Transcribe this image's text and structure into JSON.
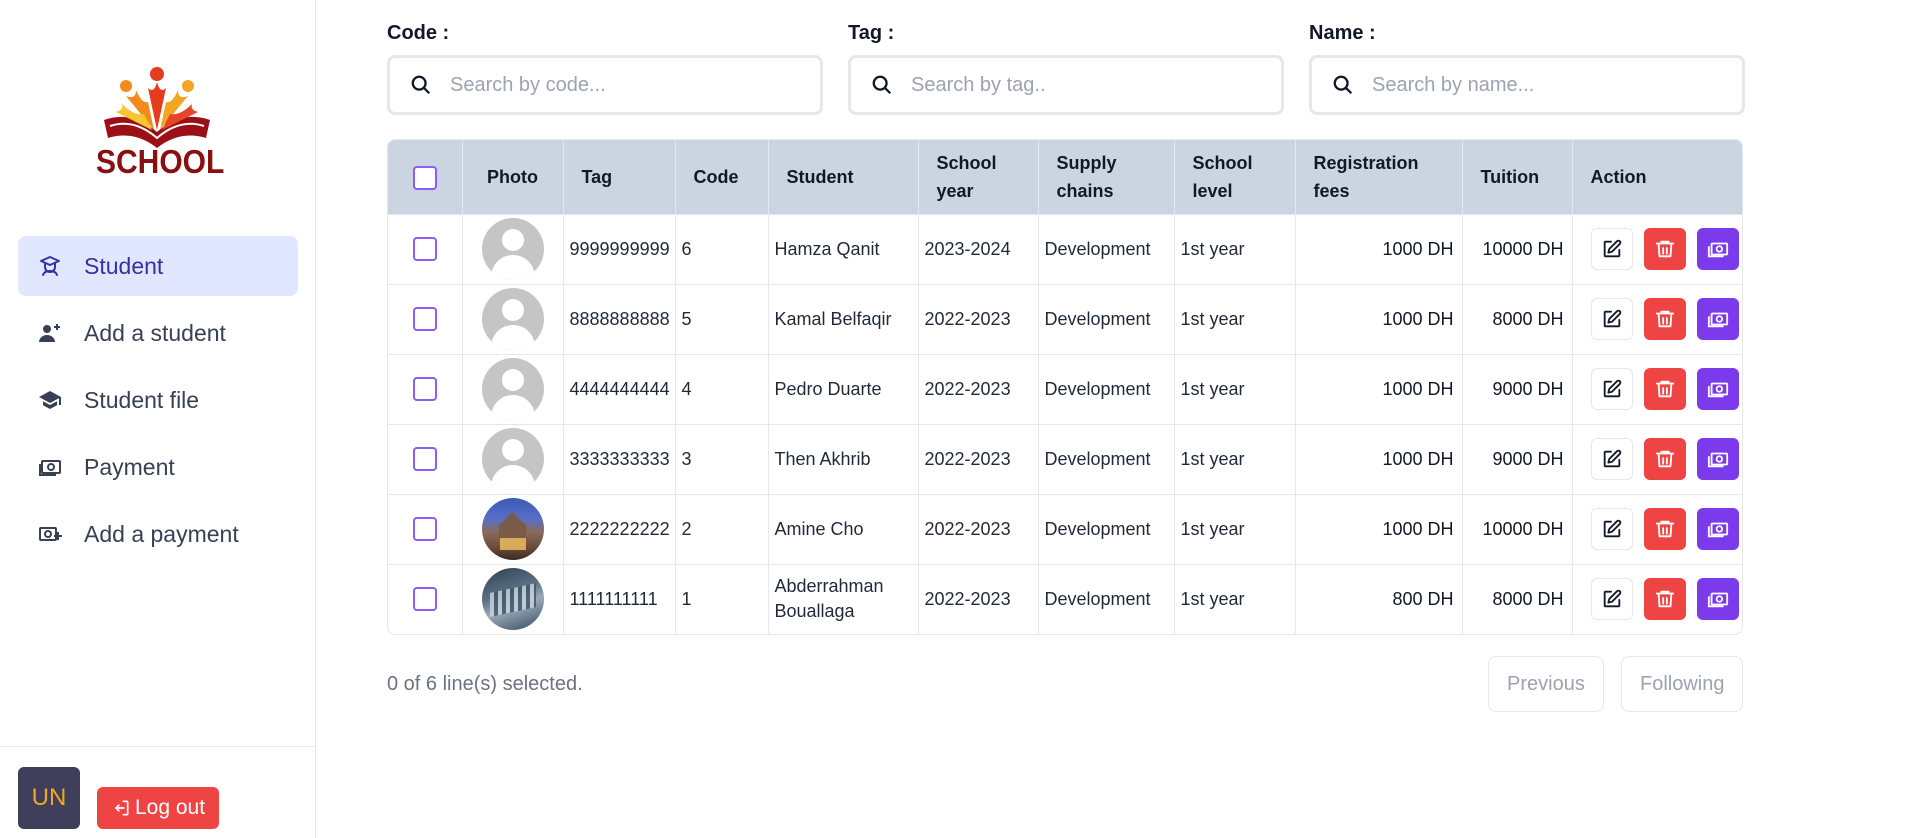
{
  "logo": {
    "text": "SCHOOL"
  },
  "sidebar": {
    "items": [
      {
        "label": "Student",
        "icon": "student-icon"
      },
      {
        "label": "Add a student",
        "icon": "add-user-icon"
      },
      {
        "label": "Student file",
        "icon": "graduation-cap-icon"
      },
      {
        "label": "Payment",
        "icon": "money-icon"
      },
      {
        "label": "Add a payment",
        "icon": "add-money-icon"
      }
    ],
    "active_index": 0
  },
  "user": {
    "initials": "UN",
    "logout_label": "Log out"
  },
  "filters": {
    "code": {
      "label": "Code :",
      "placeholder": "Search by code...",
      "value": ""
    },
    "tag": {
      "label": "Tag :",
      "placeholder": "Search by tag..",
      "value": ""
    },
    "name": {
      "label": "Name :",
      "placeholder": "Search by name...",
      "value": ""
    }
  },
  "table": {
    "headers": {
      "photo": "Photo",
      "tag": "Tag",
      "code": "Code",
      "student": "Student",
      "school_year_1": "School",
      "school_year_2": "year",
      "supply_1": "Supply",
      "supply_2": "chains",
      "level_1": "School",
      "level_2": "level",
      "fees_1": "Registration",
      "fees_2": "fees",
      "tuition": "Tuition",
      "action": "Action"
    },
    "rows": [
      {
        "tag": "9999999999",
        "code": "6",
        "student": "Hamza Qanit",
        "school_year": "2023-2024",
        "supply_chain": "Development",
        "level": "1st year",
        "fees": "1000 DH",
        "tuition": "10000 DH",
        "photo": "placeholder"
      },
      {
        "tag": "8888888888",
        "code": "5",
        "student": "Kamal Belfaqir",
        "school_year": "2022-2023",
        "supply_chain": "Development",
        "level": "1st year",
        "fees": "1000 DH",
        "tuition": "8000 DH",
        "photo": "placeholder"
      },
      {
        "tag": "4444444444",
        "code": "4",
        "student": "Pedro Duarte",
        "school_year": "2022-2023",
        "supply_chain": "Development",
        "level": "1st year",
        "fees": "1000 DH",
        "tuition": "9000 DH",
        "photo": "placeholder"
      },
      {
        "tag": "3333333333",
        "code": "3",
        "student": "Then Akhrib",
        "school_year": "2022-2023",
        "supply_chain": "Development",
        "level": "1st year",
        "fees": "1000 DH",
        "tuition": "9000 DH",
        "photo": "placeholder"
      },
      {
        "tag": "2222222222",
        "code": "2",
        "student": "Amine Cho",
        "school_year": "2022-2023",
        "supply_chain": "Development",
        "level": "1st year",
        "fees": "1000 DH",
        "tuition": "10000 DH",
        "photo": "building"
      },
      {
        "tag": "1111111111",
        "code": "1",
        "student": "Abderrahman Bouallaga",
        "school_year": "2022-2023",
        "supply_chain": "Development",
        "level": "1st year",
        "fees": "800 DH",
        "tuition": "8000 DH",
        "photo": "city"
      }
    ]
  },
  "footer": {
    "selection_text": "0 of 6 line(s) selected.",
    "previous_label": "Previous",
    "next_label": "Following"
  },
  "colors": {
    "accent": "#7c3aed",
    "danger": "#ef4444",
    "active_nav_bg": "#e0e7ff",
    "table_header_bg": "#cbd5e1"
  }
}
